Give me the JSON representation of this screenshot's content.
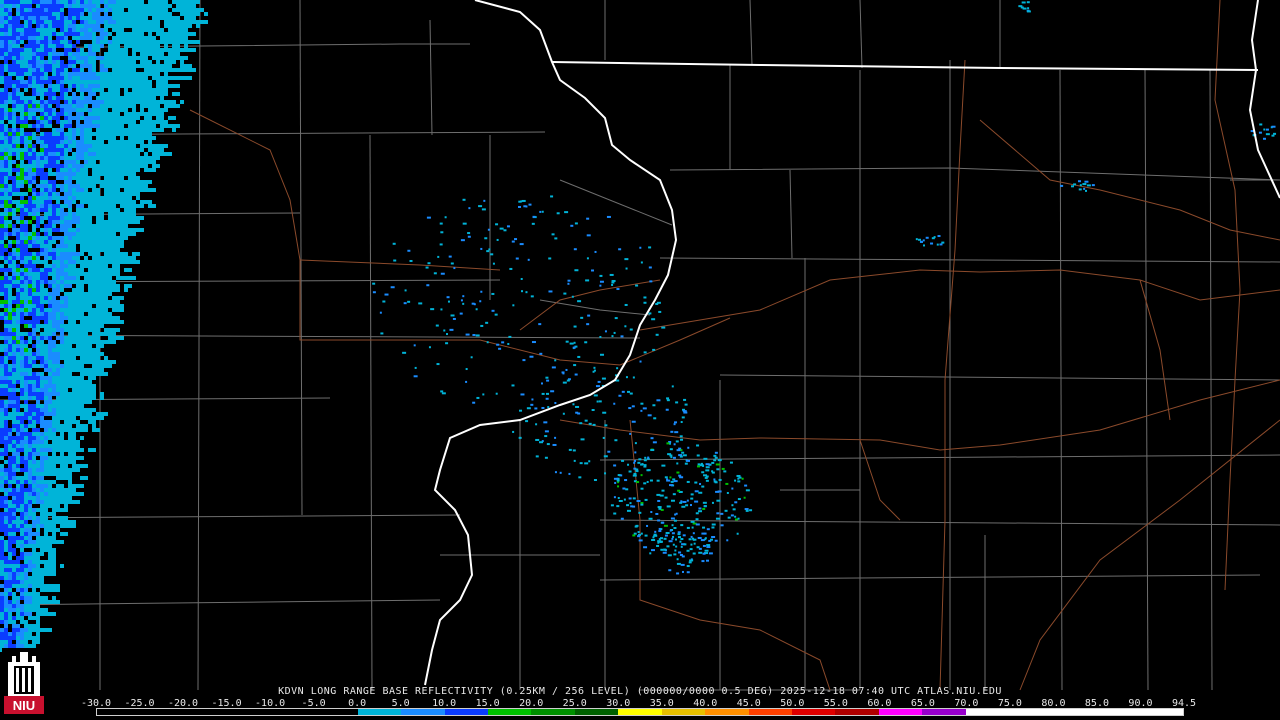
{
  "caption": "KDVN LONG RANGE BASE REFLECTIVITY (0.25KM / 256 LEVEL) (000000/0000 0.5 DEG) 2025-12-18 07:40 UTC  ATLAS.NIU.EDU",
  "logo": {
    "text": "NIU",
    "icon": "niu-tower-logo-icon",
    "color": "#c8102e"
  },
  "scale": {
    "labels": [
      "-30.0",
      "-25.0",
      "-20.0",
      "-15.0",
      "-10.0",
      "-5.0",
      "0.0",
      "5.0",
      "10.0",
      "15.0",
      "20.0",
      "25.0",
      "30.0",
      "35.0",
      "40.0",
      "45.0",
      "50.0",
      "55.0",
      "60.0",
      "65.0",
      "70.0",
      "75.0",
      "80.0",
      "85.0",
      "90.0",
      "94.5"
    ],
    "colors": [
      "#000000",
      "#000000",
      "#000000",
      "#000000",
      "#000000",
      "#000000",
      "#00b4d8",
      "#1a8cff",
      "#0a3cff",
      "#00c000",
      "#009000",
      "#006000",
      "#ffff00",
      "#e6c000",
      "#ff9000",
      "#ff4000",
      "#e00000",
      "#b00000",
      "#ff00ff",
      "#9900cc",
      "#ffffff",
      "#ffffff",
      "#ffffff",
      "#ffffff",
      "#ffffff"
    ]
  },
  "map": {
    "state_border_color": "#ffffff",
    "county_line_color": "#6e6e6e",
    "highway_color": "#8b4a2b",
    "echo_colors": {
      "weak": "#00b4d8",
      "light": "#1a8cff",
      "moderate": "#0a3cff",
      "heavy": "#00c000"
    }
  }
}
